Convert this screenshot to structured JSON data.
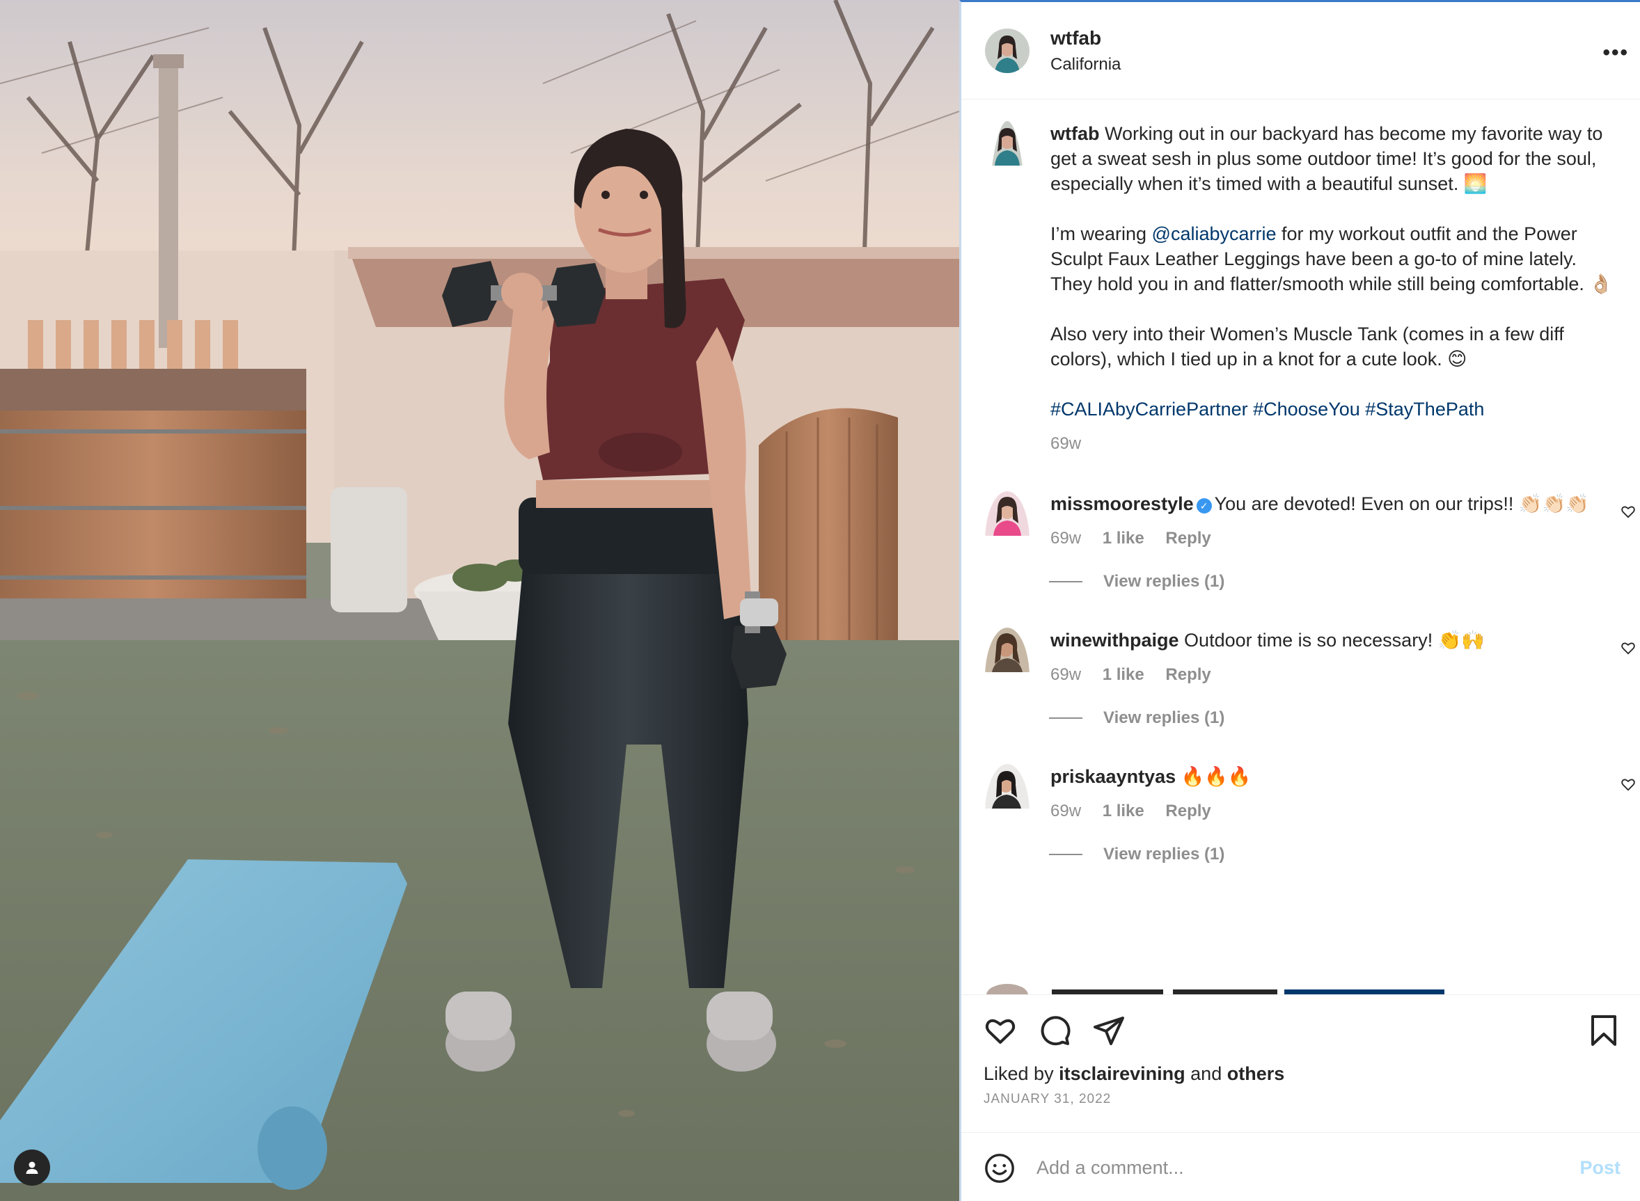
{
  "post": {
    "username": "wtfab",
    "location": "California",
    "more_icon": "more-horizontal-icon"
  },
  "caption": {
    "username": "wtfab",
    "p1": " Working out in our backyard has become my favorite way to get a sweat sesh in plus some outdoor time! It’s good for the soul, especially when it’s timed with a beautiful sunset. 🌅",
    "p2_pre": "I’m wearing ",
    "p2_mention": "@caliabycarrie",
    "p2_post": " for my workout outfit and the Power Sculpt Faux Leather Leggings have been a go-to of mine lately. They hold you in and flatter/smooth while still being comfortable. 👌🏼",
    "p3": "Also very into their Women’s Muscle Tank (comes in a few diff colors), which I tied up in a knot for a cute look. 😊",
    "hashtags": "#CALIAbyCarriePartner #ChooseYou #StayThePath",
    "time": "69w"
  },
  "comments": [
    {
      "username": "missmoorestyle",
      "verified": true,
      "text": "You are devoted! Even on our trips!! 👏🏻👏🏻👏🏻",
      "time": "69w",
      "likes": "1 like",
      "reply": "Reply",
      "view_replies": "View replies (1)"
    },
    {
      "username": "winewithpaige",
      "verified": false,
      "text": "Outdoor time is so necessary! 👏🙌",
      "time": "69w",
      "likes": "1 like",
      "reply": "Reply",
      "view_replies": "View replies (1)"
    },
    {
      "username": "priskaayntyas",
      "verified": false,
      "text": "🔥🔥🔥",
      "time": "69w",
      "likes": "1 like",
      "reply": "Reply",
      "view_replies": "View replies (1)"
    }
  ],
  "actions": {
    "liked_by_prefix": "Liked by ",
    "liked_by_user": "itsclairevining",
    "liked_by_mid": " and ",
    "liked_by_others": "others",
    "date": "JANUARY 31, 2022"
  },
  "add_comment": {
    "placeholder": "Add a comment...",
    "post_label": "Post"
  },
  "colors": {
    "text": "#262626",
    "muted": "#8e8e8e",
    "link": "#00376b",
    "verified": "#3897f0",
    "post_disabled": "#b2dffc"
  }
}
